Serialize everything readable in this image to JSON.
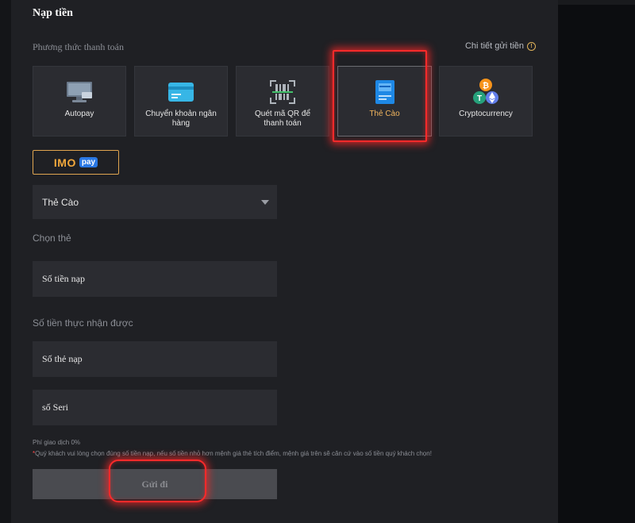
{
  "page": {
    "title": "Nạp tiền"
  },
  "payment": {
    "label": "Phương thức thanh toán",
    "detail_link": "Chi tiết gửi tiền",
    "methods": [
      {
        "label": "Autopay",
        "icon": "monitor-icon"
      },
      {
        "label": "Chuyển khoản ngân hàng",
        "icon": "bank-card-icon"
      },
      {
        "label": "Quét mã QR để thanh toán",
        "icon": "qr-scan-icon"
      },
      {
        "label": "Thẻ Cào",
        "icon": "scratch-card-icon",
        "active": true
      },
      {
        "label": "Cryptocurrency",
        "icon": "crypto-coins-icon"
      }
    ]
  },
  "provider": {
    "name": "IMO",
    "badge": "pay"
  },
  "card_type": {
    "selected": "Thẻ Cào"
  },
  "labels": {
    "choose_card": "Chọn thẻ",
    "received_amount": "Số tiền thực nhận được"
  },
  "fields": {
    "amount_placeholder": "Số tiền nạp",
    "card_number_placeholder": "Số thẻ nạp",
    "serial_placeholder": "số Seri"
  },
  "fee": "Phí giao dịch 0%",
  "note": {
    "star": "*",
    "text": "Quý khách vui lòng chọn đúng số tiền nạp, nếu số tiền nhỏ hơn mệnh giá thẻ tích điểm, mệnh giá trên sẽ căn cứ vào số tiền quý khách chọn!"
  },
  "submit": {
    "label": "Gửi đi"
  },
  "colors": {
    "accent": "#f0b45d",
    "highlight": "#ff2a2a",
    "panel": "#1f2024",
    "input": "#2b2c31"
  }
}
